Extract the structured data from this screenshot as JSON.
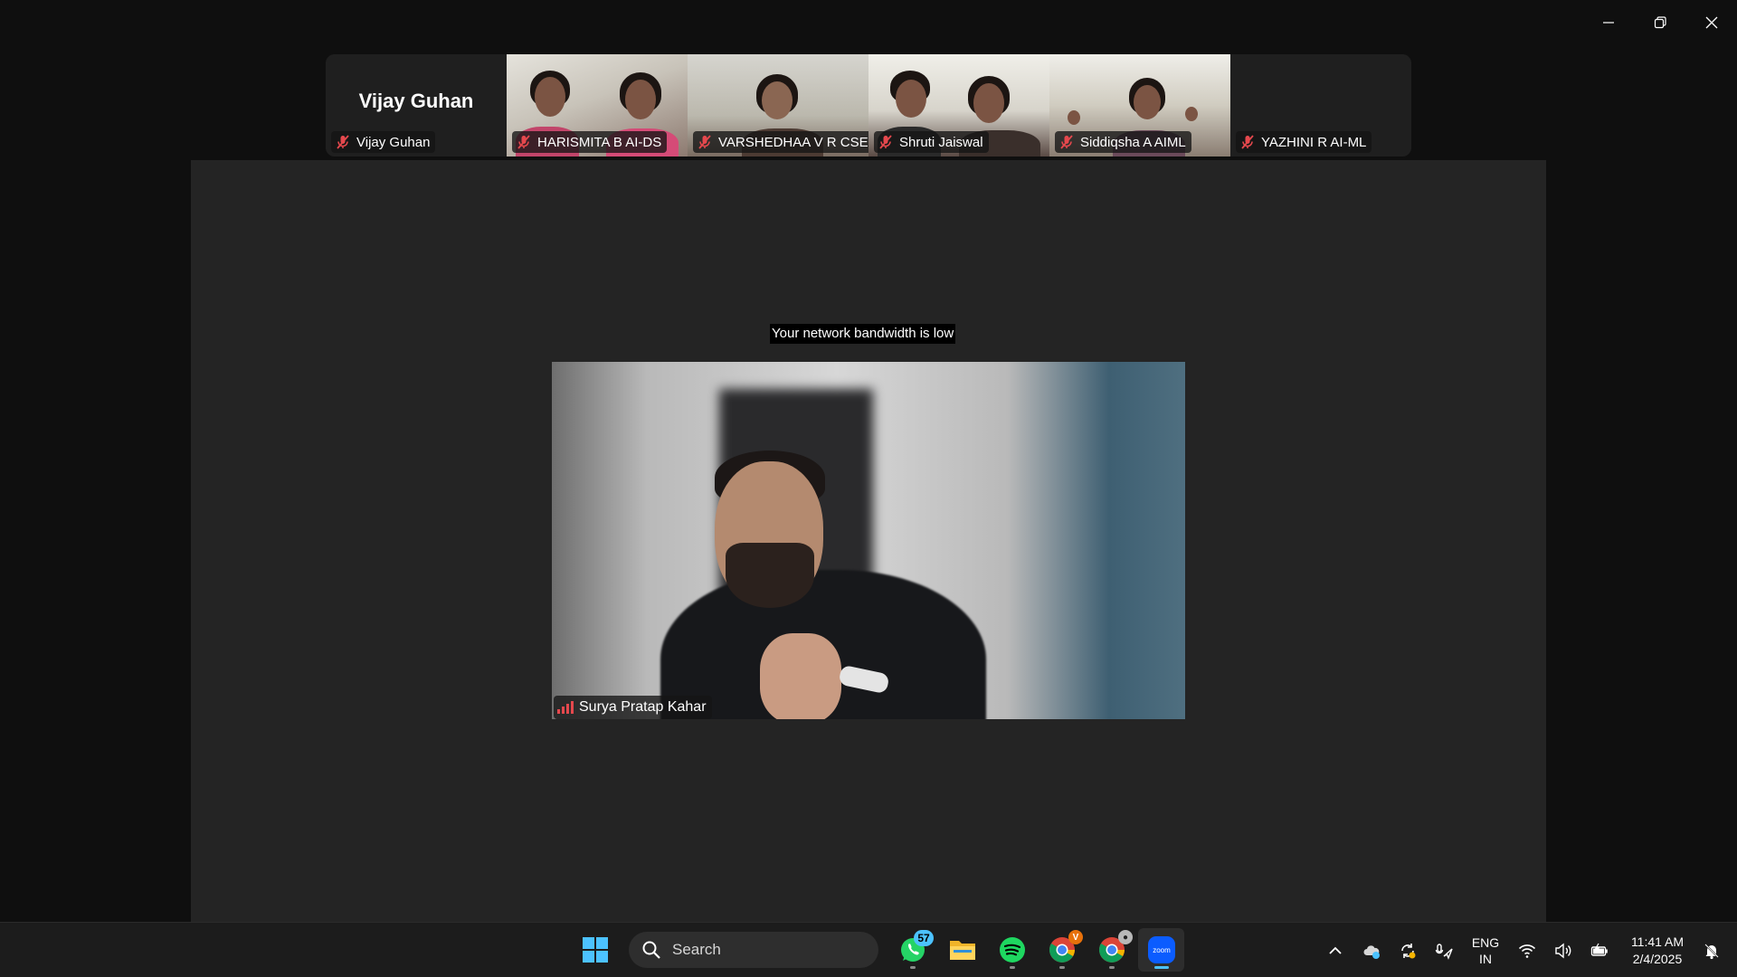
{
  "window": {
    "controls": [
      "minimize-icon",
      "restore-icon",
      "close-icon"
    ]
  },
  "gallery": {
    "tiles": [
      {
        "label": "Vijay Guhan",
        "display_name": "Vijay Guhan",
        "video": false,
        "muted": true
      },
      {
        "label": "HARISMITA B AI-DS",
        "video": true,
        "muted": true
      },
      {
        "label": "VARSHEDHAA V R CSE",
        "video": true,
        "muted": true
      },
      {
        "label": "Shruti Jaiswal",
        "video": true,
        "muted": true
      },
      {
        "label": "Siddiqsha A AIML",
        "video": true,
        "muted": true
      },
      {
        "label": "YAZHINI R AI-ML",
        "video": false,
        "muted": true
      }
    ]
  },
  "stage": {
    "notice": "Your network bandwidth is low",
    "speaker_name": "Surya Pratap Kahar",
    "connection_icon": "signal-bars-icon"
  },
  "taskbar": {
    "search_placeholder": "Search",
    "apps": [
      {
        "name": "windows-start-icon"
      },
      {
        "name": "whatsapp-icon",
        "badge": "57"
      },
      {
        "name": "file-explorer-icon"
      },
      {
        "name": "spotify-icon"
      },
      {
        "name": "chrome-icon"
      },
      {
        "name": "chrome-profile-icon"
      },
      {
        "name": "zoom-icon",
        "label": "zoom",
        "active": true
      }
    ],
    "tray": {
      "lang_line1": "ENG",
      "lang_line2": "IN",
      "time": "11:41 AM",
      "date": "2/4/2025"
    }
  },
  "colors": {
    "accent": "#4cc2ff",
    "mute_red": "#e5484d",
    "stage_bg": "#242424",
    "gallery_bg": "#232323"
  }
}
